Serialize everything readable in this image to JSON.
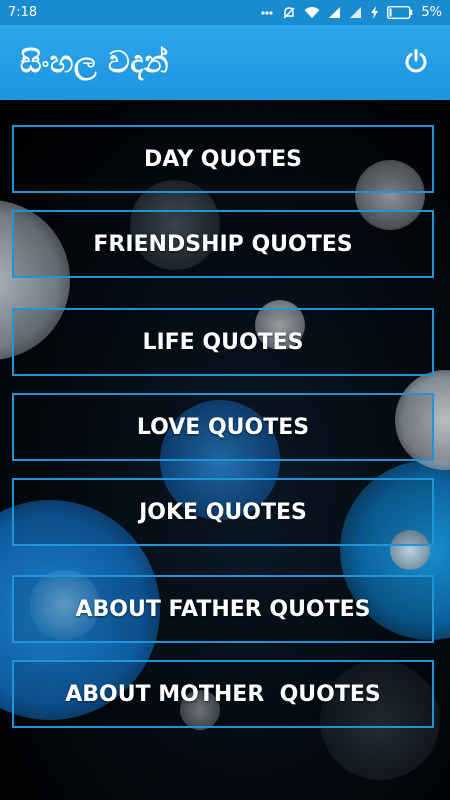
{
  "status_bar": {
    "time": "7:18",
    "battery_percent": "5%",
    "icons": [
      "mute-icon",
      "alarm-icon",
      "wifi-icon",
      "signal-icon",
      "signal-icon",
      "charging-icon",
      "battery-icon"
    ]
  },
  "app_bar": {
    "title": "සිංහල වදන්",
    "power_icon": "power-icon",
    "background_color": "#2ea6eb"
  },
  "menu": {
    "accent_color": "#1f95d8",
    "items": [
      {
        "label": "DAY QUOTES"
      },
      {
        "label": "FRIENDSHIP QUOTES"
      },
      {
        "label": "LIFE QUOTES"
      },
      {
        "label": "LOVE QUOTES"
      },
      {
        "label": "JOKE QUOTES"
      },
      {
        "label": "ABOUT FATHER QUOTES"
      },
      {
        "label": "ABOUT MOTHER  QUOTES"
      }
    ]
  }
}
